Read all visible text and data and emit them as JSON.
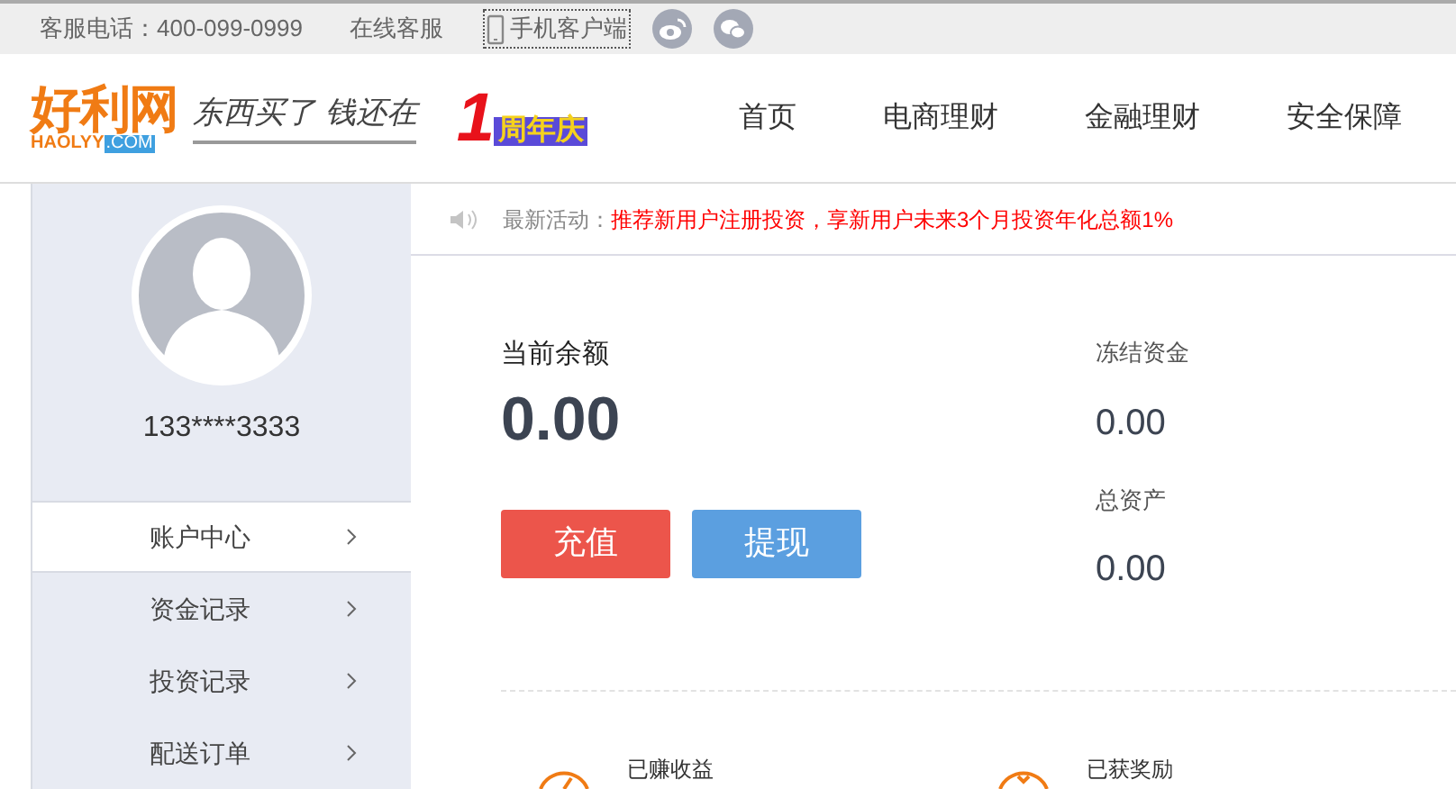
{
  "top_bar": {
    "hotline": "客服电话：400-099-0999",
    "online_service": "在线客服",
    "mobile_client": "手机客户端"
  },
  "header": {
    "logo": {
      "name": "好利网",
      "domain": "HAOLYY",
      "tld": ".COM"
    },
    "slogan": "东西买了 钱还在",
    "anniversary": {
      "number": "1",
      "text": "周年庆"
    },
    "nav": [
      {
        "label": "首页",
        "selected": false
      },
      {
        "label": "电商理财",
        "selected": false
      },
      {
        "label": "金融理财",
        "selected": false
      },
      {
        "label": "安全保障",
        "selected": false
      }
    ]
  },
  "sidebar": {
    "username": "133****3333",
    "items": [
      {
        "label": "账户中心",
        "selected": true
      },
      {
        "label": "资金记录",
        "selected": false
      },
      {
        "label": "投资记录",
        "selected": false
      },
      {
        "label": "配送订单",
        "selected": false
      }
    ]
  },
  "notice": {
    "label": "最新活动：",
    "text": "推荐新用户注册投资，享新用户未来3个月投资年化总额1%"
  },
  "balance": {
    "label": "当前余额",
    "value": "0.00",
    "buttons": [
      {
        "label": "充值",
        "kind": "recharge"
      },
      {
        "label": "提现",
        "kind": "withdraw"
      }
    ]
  },
  "side_stats": [
    {
      "label": "冻结资金",
      "value": "0.00"
    },
    {
      "label": "总资产",
      "value": "0.00"
    }
  ],
  "summary": [
    {
      "label": "已赚收益",
      "kind": "earned"
    },
    {
      "label": "已获奖励",
      "kind": "reward"
    }
  ]
}
